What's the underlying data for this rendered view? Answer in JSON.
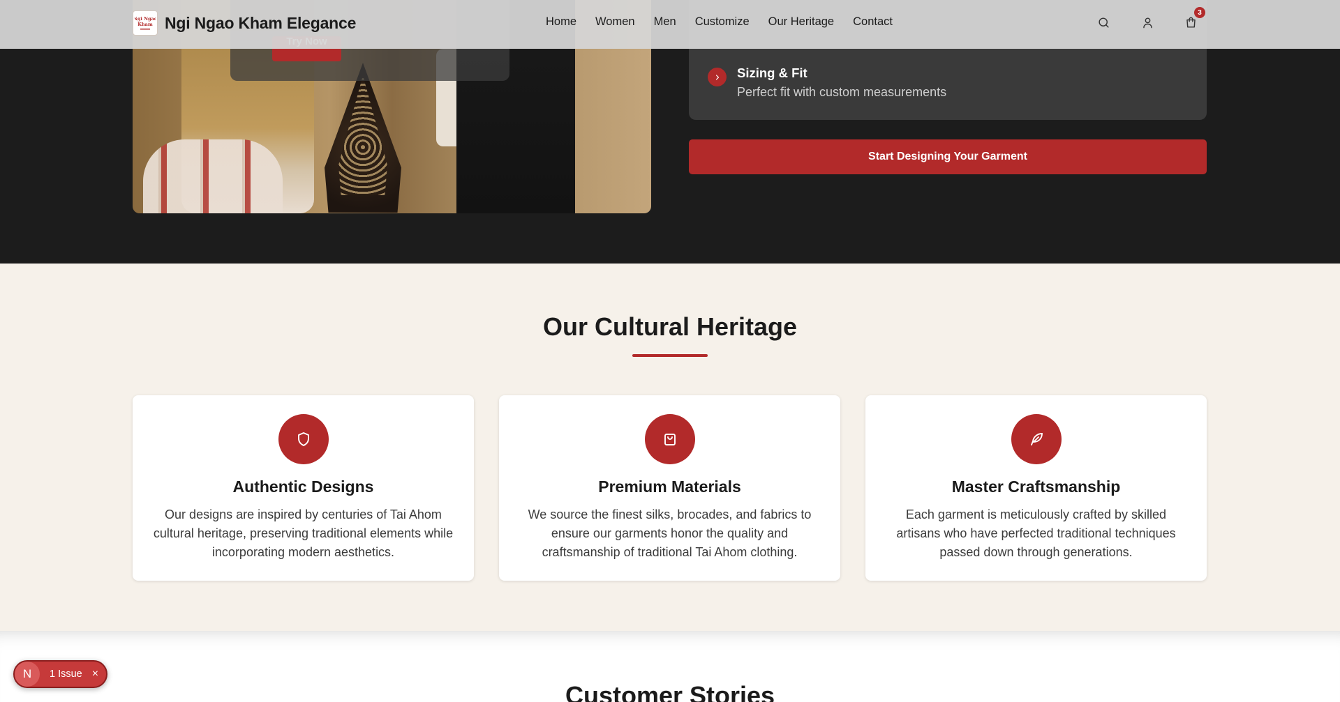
{
  "header": {
    "brand_logo_text": "Ngi Ngao Kham",
    "brand_name": "Ngi Ngao Kham Elegance",
    "nav": [
      "Home",
      "Women",
      "Men",
      "Customize",
      "Our Heritage",
      "Contact"
    ],
    "cart_count": "3",
    "icons": [
      "search-icon",
      "user-icon",
      "shopping-bag-icon"
    ]
  },
  "hero": {
    "try_now_label": "Try Now",
    "feature": {
      "title": "Sizing & Fit",
      "description": "Perfect fit with custom measurements"
    },
    "cta_label": "Start Designing Your Garment"
  },
  "heritage": {
    "title": "Our Cultural Heritage",
    "cards": [
      {
        "icon": "shield-icon",
        "title": "Authentic Designs",
        "description": "Our designs are inspired by centuries of Tai Ahom cultural heritage, preserving traditional elements while incorporating modern aesthetics."
      },
      {
        "icon": "shopping-bag-icon",
        "title": "Premium Materials",
        "description": "We source the finest silks, brocades, and fabrics to ensure our garments honor the quality and craftsmanship of traditional Tai Ahom clothing."
      },
      {
        "icon": "feather-icon",
        "title": "Master Craftsmanship",
        "description": "Each garment is meticulously crafted by skilled artisans who have perfected traditional techniques passed down through generations."
      }
    ]
  },
  "stories": {
    "title": "Customer Stories"
  },
  "dev_indicator": {
    "letter": "N",
    "label": "1 Issue",
    "close": "×"
  },
  "colors": {
    "accent": "#b22a2a",
    "dark_bg": "#1c1c1c",
    "heritage_bg": "#f6f1ea"
  }
}
